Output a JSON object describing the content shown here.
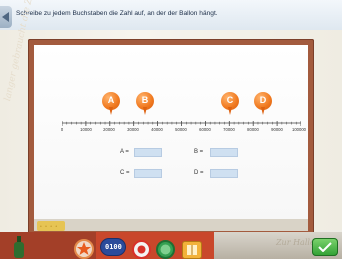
{
  "header": {
    "instruction": "Schreibe zu jedem Buchstaben die Zahl auf, an der der Ballon hängt."
  },
  "wallpaper": {
    "script_text": "langer gebraucht die Ziffern"
  },
  "board": {
    "balloons": [
      {
        "letter": "A",
        "value": 20000
      },
      {
        "letter": "B",
        "value": 35000
      },
      {
        "letter": "C",
        "value": 72000
      },
      {
        "letter": "D",
        "value": 87000
      }
    ],
    "axis": {
      "min": 0,
      "max": 100000,
      "tick_labels": [
        "0",
        "10000",
        "20000",
        "30000",
        "40000",
        "50000",
        "60000",
        "70000",
        "80000",
        "90000",
        "100000"
      ]
    },
    "answers": [
      {
        "label": "A =",
        "value": ""
      },
      {
        "label": "B =",
        "value": ""
      },
      {
        "label": "C =",
        "value": ""
      },
      {
        "label": "D =",
        "value": ""
      }
    ]
  },
  "toolbar": {
    "counter": "0100",
    "signature": "Zur Halle"
  },
  "colors": {
    "balloon": "#f0781e",
    "board_frame": "#a35b3e",
    "answer_field": "#cfe0f1",
    "ok_button": "#2f9f32"
  },
  "icons": [
    "back-arrow-icon",
    "balloon-icon",
    "star-icon",
    "counter-icon",
    "help-icon",
    "globe-icon",
    "book-icon",
    "checkmark-icon",
    "bottle-icon"
  ]
}
